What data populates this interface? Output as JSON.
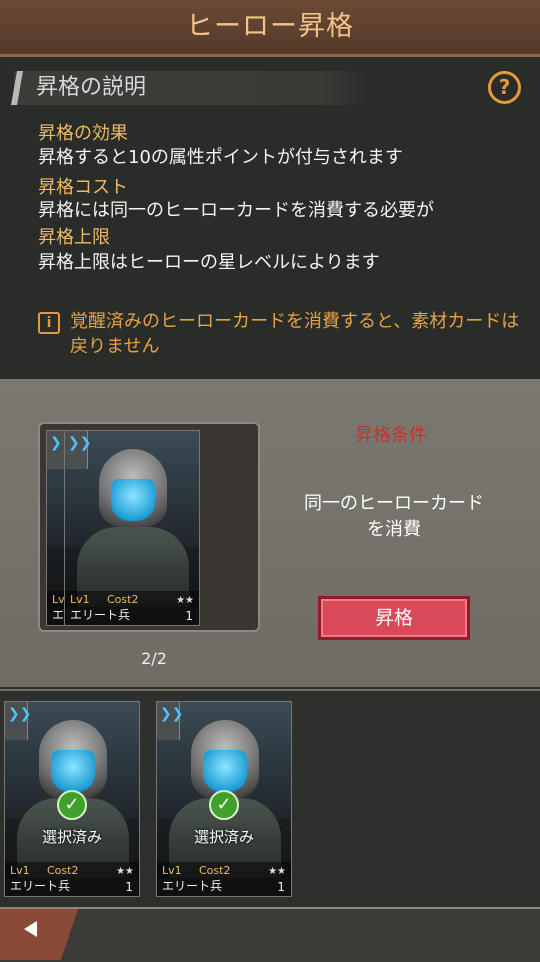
{
  "header": {
    "title": "ヒーロー昇格"
  },
  "description": {
    "section_title": "昇格の説明",
    "help_glyph": "?",
    "effect_heading": "昇格の効果",
    "effect_text": "昇格すると10の属性ポイントが付与されます",
    "cost_heading": "昇格コスト",
    "cost_text": "昇格には同一のヒーローカードを消費する必要が",
    "limit_heading": "昇格上限",
    "limit_text": "昇格上限はヒーローの星レベルによります",
    "warning_glyph": "i",
    "warning_text": "覚醒済みのヒーローカードを消費すると、素材カードは戻りません"
  },
  "upgrade": {
    "condition_label": "昇格条件",
    "condition_text": "同一のヒーローカードを消費",
    "button_label": "昇格",
    "stack_count": "2/2"
  },
  "hero_card": {
    "level": "Lv1",
    "cost": "Cost2",
    "stars": "★★",
    "name": "エリート兵",
    "count": "1"
  },
  "selection": {
    "selected_label": "選択済み",
    "check_glyph": "✓"
  },
  "colors": {
    "header_bg": "#5f4230",
    "title_color": "#f0c48a",
    "accent_orange": "#e59a3a",
    "button_red": "#d9495a",
    "condition_red": "#c0352e"
  },
  "icons": {
    "help": "question-circle-icon",
    "warning": "info-icon",
    "back": "back-arrow-icon",
    "rank": "chevron-rank-icon",
    "check": "check-circle-icon"
  }
}
